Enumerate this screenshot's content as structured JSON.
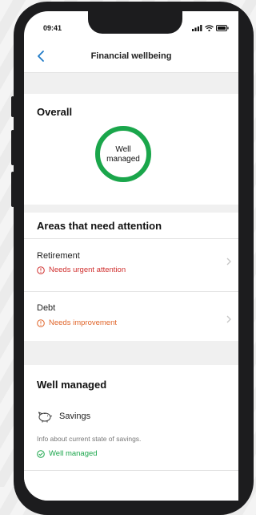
{
  "status_bar": {
    "time": "09:41",
    "icons": [
      "signal-icon",
      "wifi-icon",
      "battery-icon"
    ]
  },
  "nav": {
    "title": "Financial wellbeing",
    "back_icon": "chevron-left-icon"
  },
  "overall": {
    "heading": "Overall",
    "status_line1": "Well",
    "status_line2": "managed",
    "ring_color": "#1aa64b"
  },
  "attention": {
    "heading": "Areas that need attention",
    "items": [
      {
        "title": "Retirement",
        "status": "Needs urgent attention",
        "status_color": "#d0302f",
        "icon": "alert-circle-icon"
      },
      {
        "title": "Debt",
        "status": "Needs improvement",
        "status_color": "#e0652a",
        "icon": "alert-circle-icon"
      }
    ]
  },
  "well_managed": {
    "heading": "Well managed",
    "items": [
      {
        "title": "Savings",
        "icon": "piggy-bank-icon",
        "description": "Info about current state of savings.",
        "status": "Well managed",
        "status_color": "#1aa64b"
      }
    ]
  },
  "colors": {
    "accent": "#1f7ac7",
    "success": "#1aa64b",
    "danger": "#d0302f",
    "warning": "#e0652a"
  }
}
